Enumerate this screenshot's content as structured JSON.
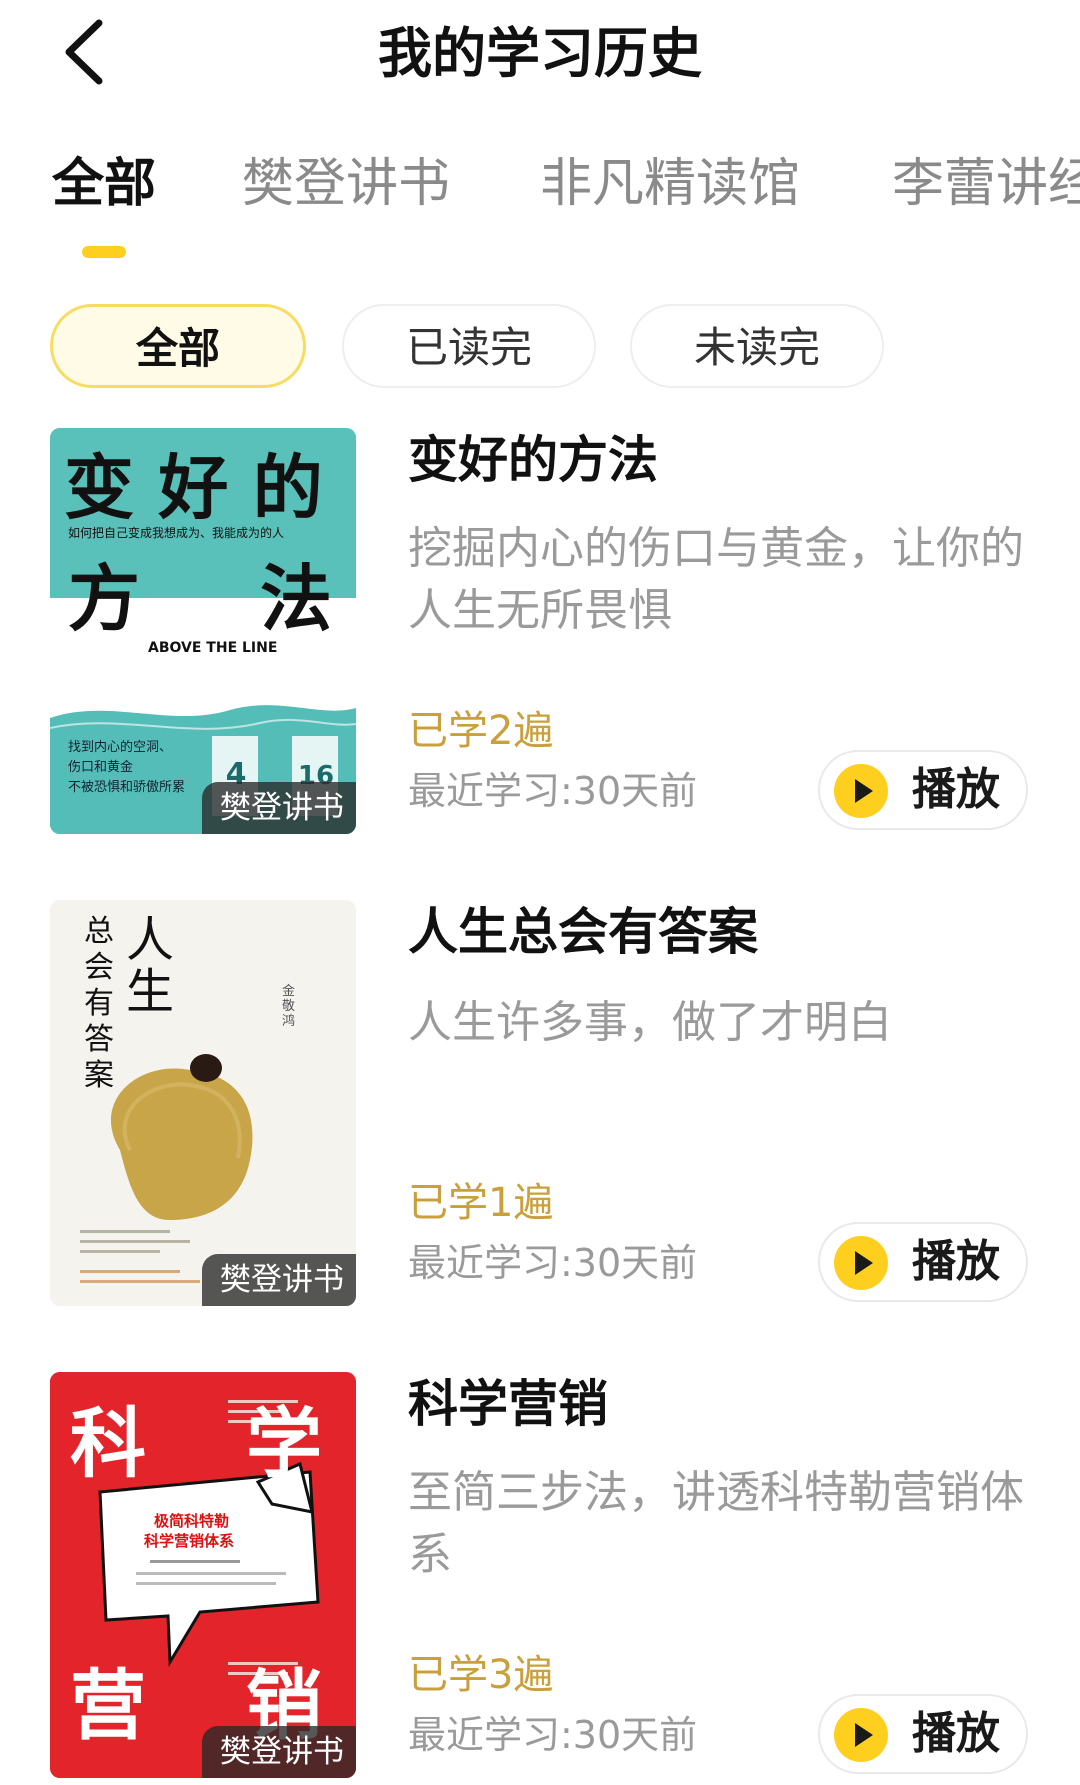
{
  "header": {
    "title": "我的学习历史"
  },
  "tabs": [
    "全部",
    "樊登讲书",
    "非凡精读馆",
    "李蕾讲经典"
  ],
  "filters": [
    "全部",
    "已读完",
    "未读完"
  ],
  "books": [
    {
      "title": "变好的方法",
      "desc": "挖掘内心的伤口与黄金，让你的人生无所畏惧",
      "times": "已学2遍",
      "last": "最近学习:30天前",
      "play": "播放",
      "badge": "樊登讲书",
      "cover": {
        "big_top": "变 好 的",
        "sub": "如何把自己变成我想成为、我能成为的人",
        "big_mid_left": "方",
        "big_mid_right": "法",
        "en": "ABOVE THE LINE",
        "lines": [
          "找到内心的空洞、",
          "伤口和黄金",
          "不被恐惧和骄傲所累"
        ],
        "num1": "4",
        "num2": "16"
      }
    },
    {
      "title": "人生总会有答案",
      "desc": "人生许多事，做了才明白",
      "times": "已学1遍",
      "last": "最近学习:30天前",
      "play": "播放",
      "badge": "樊登讲书",
      "cover": {
        "title_col1": "人生",
        "title_col2": "总会有答案",
        "author": "金敬鸿"
      }
    },
    {
      "title": "科学营销",
      "desc": "至简三步法，讲透科特勒营销体系",
      "times": "已学3遍",
      "last": "最近学习:30天前",
      "play": "播放",
      "badge": "樊登讲书",
      "cover": {
        "top_left": "科",
        "top_right": "学",
        "bottom_left": "营",
        "bottom_right": "销",
        "bubble1": "极简科特勒",
        "bubble2": "科学营销体系"
      }
    }
  ],
  "colors": {
    "accent": "#ffcf1f",
    "gold_text": "#c9a03c",
    "muted": "#9a9a9a"
  },
  "icons": {
    "back": "chevron-left-icon",
    "play": "play-icon"
  }
}
